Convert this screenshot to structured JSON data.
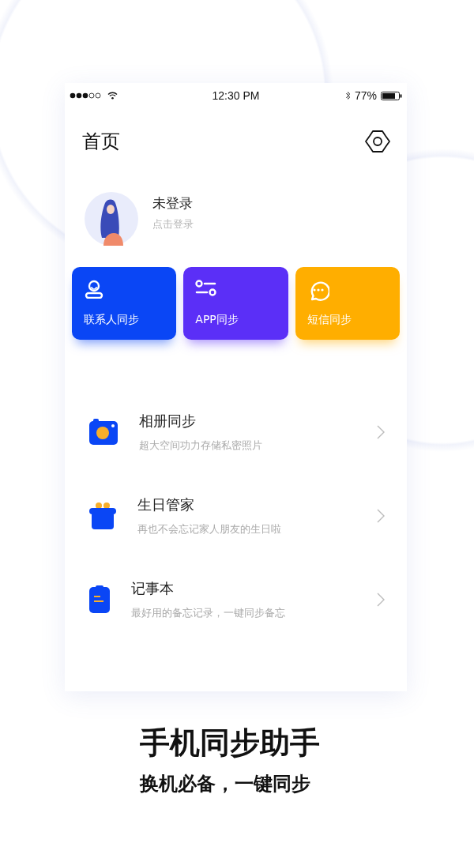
{
  "status_bar": {
    "time": "12:30 PM",
    "battery": "77%"
  },
  "header": {
    "title": "首页"
  },
  "profile": {
    "name": "未登录",
    "hint": "点击登录"
  },
  "sync_cards": [
    {
      "kind": "contacts",
      "label": "联系人同步",
      "color": "#0a46f5"
    },
    {
      "kind": "apps",
      "label": "APP同步",
      "color": "#5b2ff7"
    },
    {
      "kind": "messages",
      "label": "短信同步",
      "color": "#ffae00"
    }
  ],
  "features": [
    {
      "kind": "camera",
      "title": "相册同步",
      "subtitle": "超大空间功力存储私密照片"
    },
    {
      "kind": "gift",
      "title": "生日管家",
      "subtitle": "再也不会忘记家人朋友的生日啦"
    },
    {
      "kind": "notes",
      "title": "记事本",
      "subtitle": "最好用的备忘记录，一键同步备忘"
    }
  ],
  "headline": "手机同步助手",
  "tagline": "换机必备，一键同步"
}
